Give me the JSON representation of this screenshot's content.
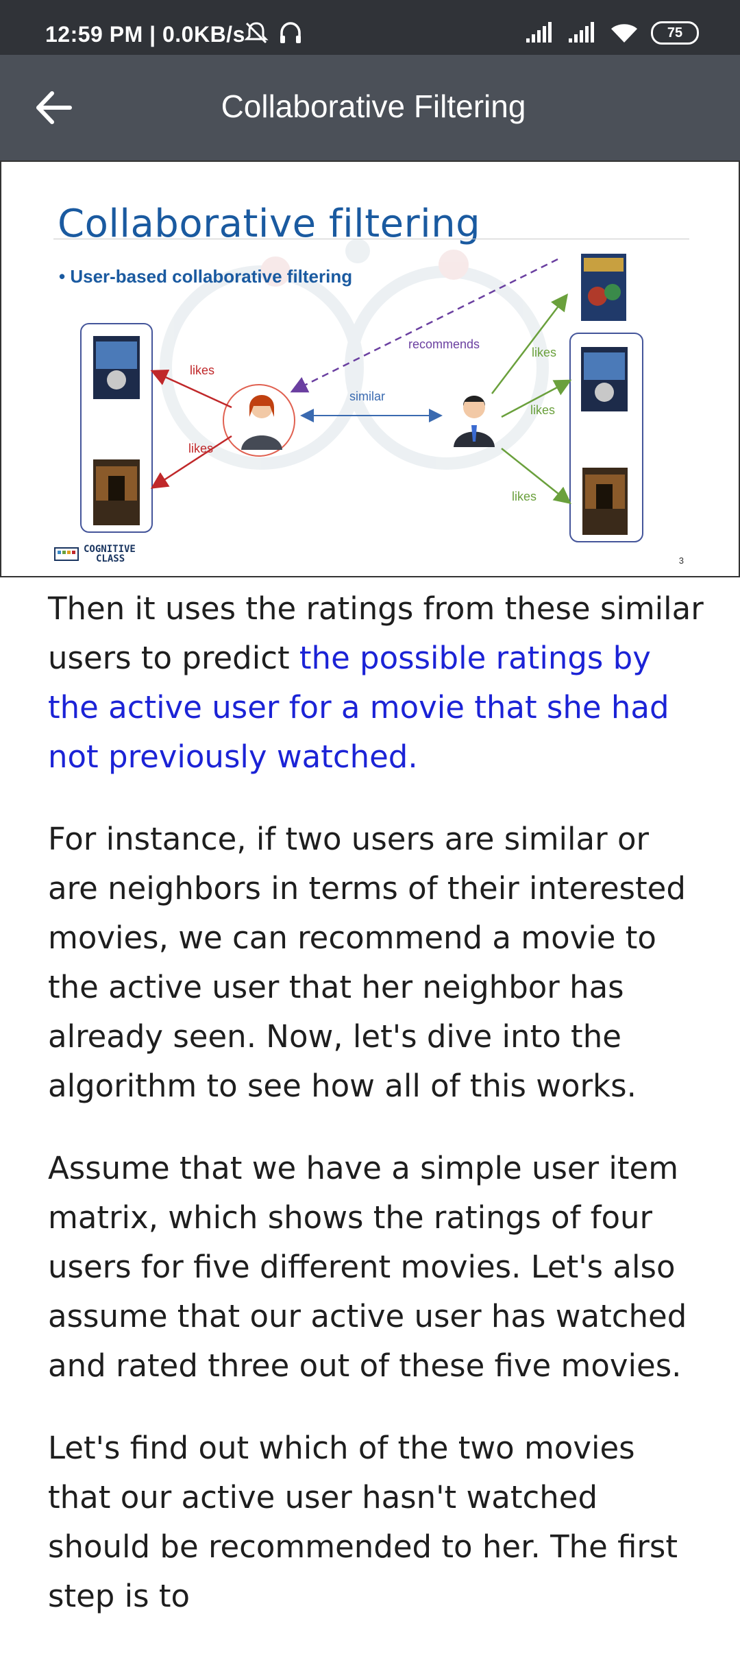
{
  "status_bar": {
    "time": "12:59 PM | 0.0KB/s",
    "battery": "75"
  },
  "app_bar": {
    "title": "Collaborative Filtering"
  },
  "slide": {
    "title": "Collaborative filtering",
    "bullet": "User-based collaborative filtering",
    "labels": {
      "recommends": "recommends",
      "similar": "similar",
      "likes": "likes"
    },
    "logo_line1": "COGNITIVE",
    "logo_line2": "CLASS",
    "page_number": "3",
    "colors": {
      "title": "#1a5aa0",
      "likes_left": "#c0282a",
      "likes_right": "#6aa03c",
      "recommends": "#6a3fa0",
      "similar": "#3a6ab0"
    }
  },
  "article": {
    "p1_plain": "Then it uses the ratings from these similar users to predict ",
    "p1_highlight": "the possible ratings by the active user for a movie that she had not previously watched.",
    "p2": "For instance, if two users are similar or are neighbors in terms of their interested movies, we can recommend a movie to the active user that her neighbor has already seen. Now, let's dive into the algorithm to see how all of this works.",
    "p3": "Assume that we have a simple user item matrix, which shows the ratings of four users for five different movies. Let's also assume that our active user has watched and rated three out of these five movies.",
    "p4": "Let's find out which of the two movies that our active user hasn't watched should be recommended to her. The first step is to"
  },
  "theme": {
    "status_bg": "#303338",
    "appbar_bg": "#4b5058",
    "highlight": "#1b23d6"
  }
}
